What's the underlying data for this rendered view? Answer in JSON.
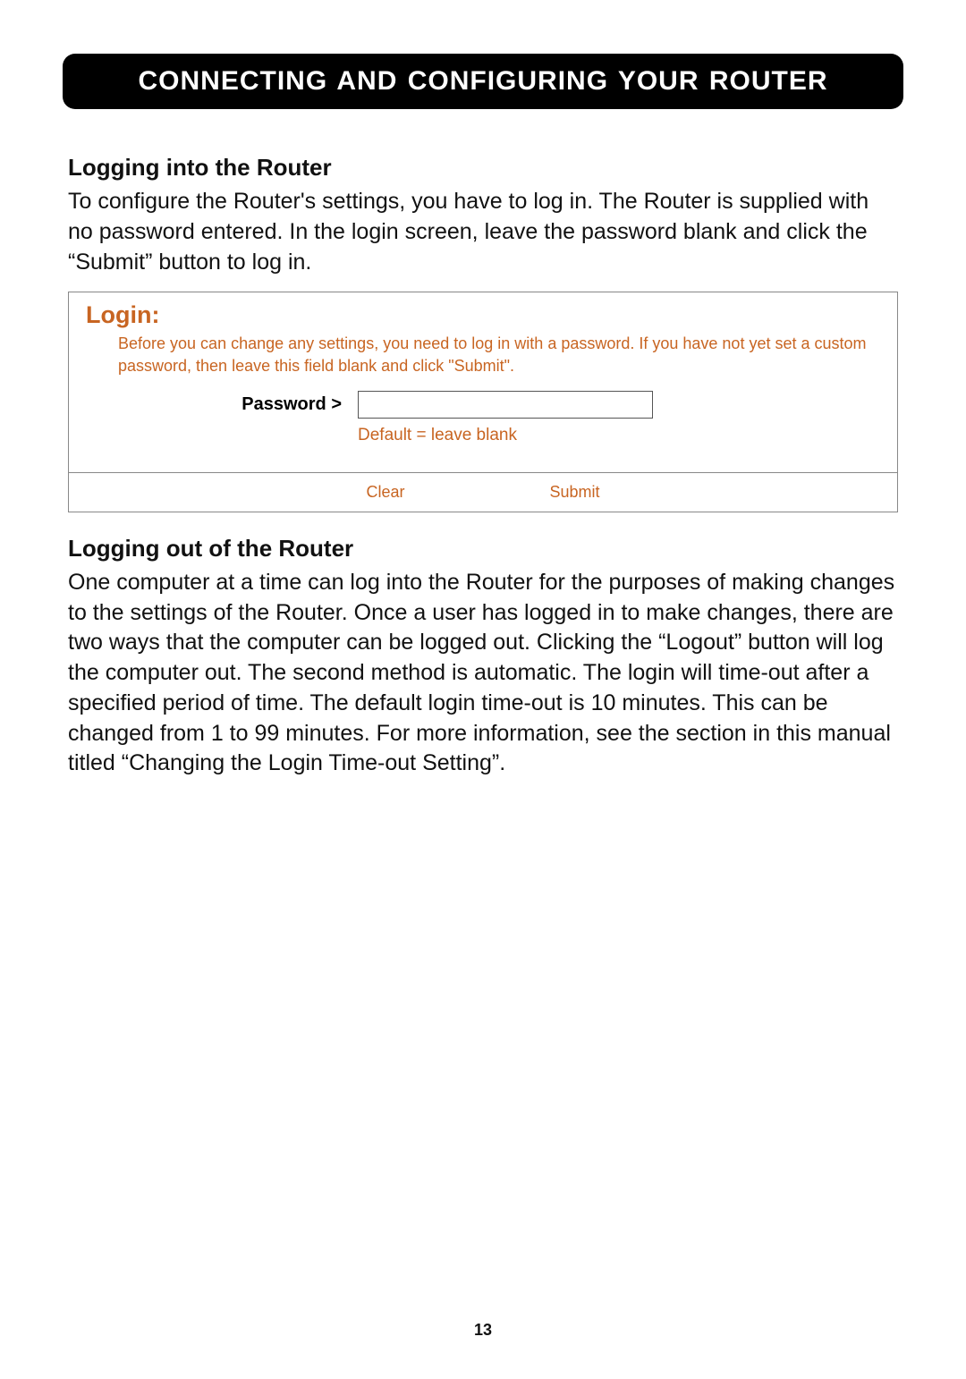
{
  "banner": {
    "title": "CONNECTING AND CONFIGURING YOUR ROUTER"
  },
  "sections": {
    "login_heading": "Logging into the Router",
    "login_paragraph": "To configure the Router's settings, you have to log in. The Router is supplied with no password entered. In the login screen, leave the password blank and click the “Submit” button to log in.",
    "logout_heading": "Logging out of the Router",
    "logout_paragraph": "One computer at a time can log into the Router for the purposes of making changes to the settings of the Router. Once a user has logged in to make changes, there are two ways that the computer can be logged out. Clicking the “Logout” button will log the computer out. The second method is automatic. The login will time-out after a specified period of time. The default login time-out is 10 minutes. This can be changed from 1 to 99 minutes. For more information, see the section in this manual titled “Changing the Login Time-out Setting”."
  },
  "login_panel": {
    "title": "Login:",
    "help_text": "Before you can change any settings, you need to log in with a password. If you have not yet set a custom password, then leave this field blank and click \"Submit\".",
    "password_label": "Password >",
    "password_value": "",
    "password_hint": "Default = leave blank",
    "clear_button": "Clear",
    "submit_button": "Submit"
  },
  "page_number": "13"
}
